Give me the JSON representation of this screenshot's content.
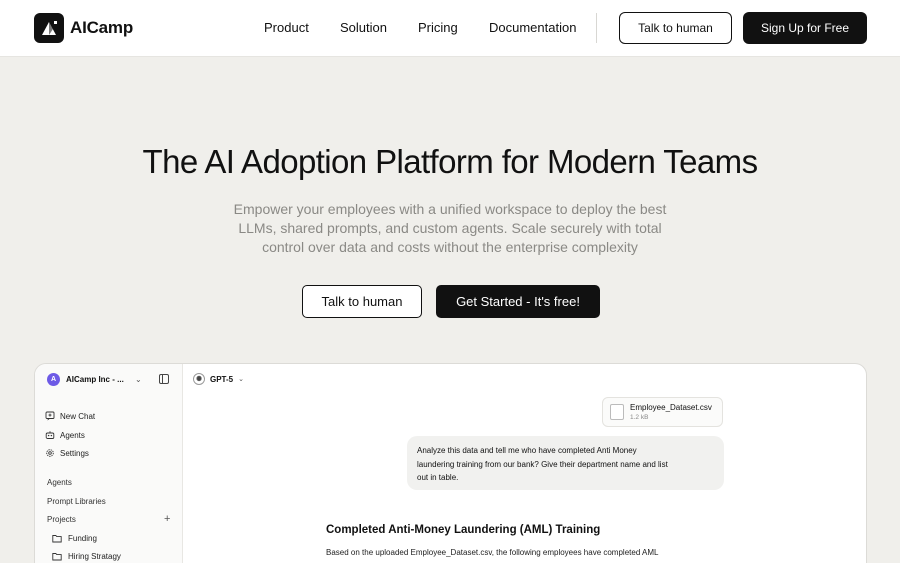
{
  "header": {
    "brand": "AICamp",
    "nav": [
      "Product",
      "Solution",
      "Pricing",
      "Documentation"
    ],
    "talk_button": "Talk to human",
    "signup_button": "Sign Up for Free"
  },
  "hero": {
    "title": "The AI Adoption Platform for Modern Teams",
    "subtitle_line1": "Empower your employees with a unified workspace to deploy the best",
    "subtitle_line2": "LLMs, shared prompts, and custom agents. Scale securely with total",
    "subtitle_line3": "control over data and costs without the enterprise complexity",
    "talk_button": "Talk to human",
    "cta_button": "Get Started - It's free!"
  },
  "app_preview": {
    "workspace": {
      "avatar": "A",
      "name": "AICamp Inc - ..."
    },
    "sidebar": {
      "primary": [
        {
          "label": "New Chat",
          "icon": "new-chat-icon"
        },
        {
          "label": "Agents",
          "icon": "agents-icon"
        },
        {
          "label": "Settings",
          "icon": "gear-icon"
        }
      ],
      "sections": [
        "Agents",
        "Prompt Libraries",
        "Projects"
      ],
      "projects": [
        "Funding",
        "Hiring Stratagy"
      ]
    },
    "model": "GPT-5",
    "attachment": {
      "name": "Employee_Dataset.csv",
      "size": "1.2 kB"
    },
    "user_message": {
      "line1": "Analyze this data and tell me who have completed Anti Money",
      "line2": "laundering training from our bank? Give their department name and list",
      "line3": "out in table."
    },
    "response": {
      "title": "Completed Anti-Money Laundering (AML) Training",
      "body": "Based on the uploaded Employee_Dataset.csv, the following employees have completed AML"
    }
  },
  "colors": {
    "page_bg": "#f0efeb",
    "primary_dark": "#111111",
    "muted_text": "#8a8985",
    "workspace_accent": "#6d5ae6"
  }
}
